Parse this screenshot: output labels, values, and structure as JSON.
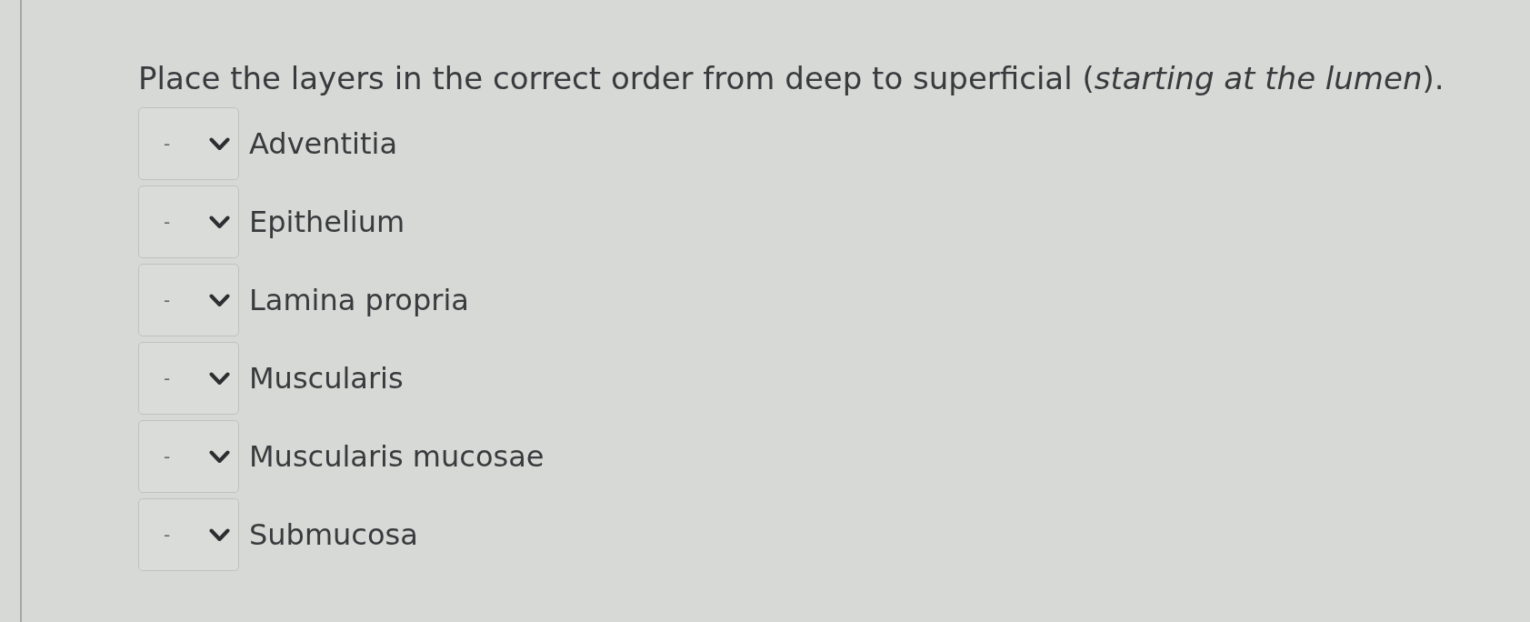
{
  "question": "Place the layers in the correct order from deep to superficial (*starting at the lumen*).",
  "items": [
    {
      "select_value": "-",
      "label": "Adventitia"
    },
    {
      "select_value": "-",
      "label": "Epithelium"
    },
    {
      "select_value": "-",
      "label": "Lamina propria"
    },
    {
      "select_value": "-",
      "label": "Muscularis"
    },
    {
      "select_value": "-",
      "label": "Muscularis mucosae"
    },
    {
      "select_value": "-",
      "label": "Submucosa"
    }
  ]
}
